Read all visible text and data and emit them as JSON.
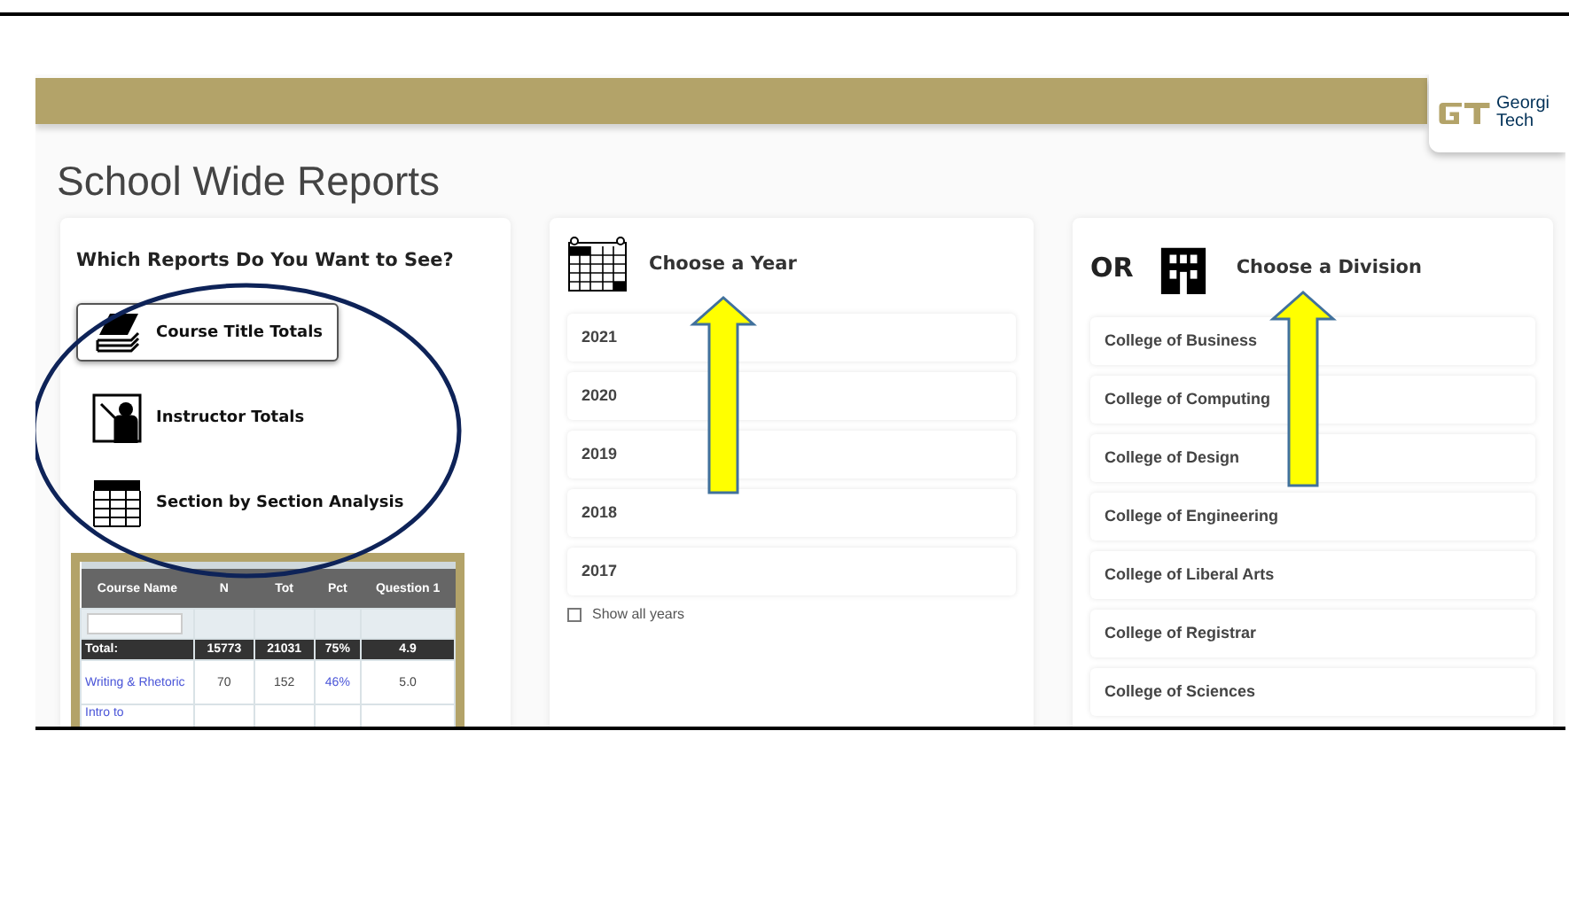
{
  "logo": {
    "line_1": "Georgi",
    "line_2": "Tech"
  },
  "page_title": "School Wide Reports",
  "reports": {
    "heading": "Which Reports Do You Want to See?",
    "options": [
      {
        "label": "Course Title Totals",
        "kind": "books",
        "selected": true
      },
      {
        "label": "Instructor Totals",
        "kind": "teacher",
        "selected": false
      },
      {
        "label": "Section by Section Analysis",
        "kind": "grid",
        "selected": false
      }
    ],
    "preview_table": {
      "columns": [
        "Course Name",
        "N",
        "Tot",
        "Pct",
        "Question 1"
      ],
      "total": [
        "Total:",
        "15773",
        "21031",
        "75%",
        "4.9"
      ],
      "rows": [
        [
          "Writing & Rhetoric",
          "70",
          "152",
          "46%",
          "5.0"
        ],
        [
          "Intro to",
          "",
          "",
          "",
          ""
        ]
      ]
    }
  },
  "years": {
    "heading": "Choose a Year",
    "items": [
      "2021",
      "2020",
      "2019",
      "2018",
      "2017"
    ],
    "show_all": {
      "label": "Show all years",
      "checked": false
    }
  },
  "divisions": {
    "prefix": "OR",
    "heading": "Choose a Division",
    "items": [
      "College of Business",
      "College of Computing",
      "College of Design",
      "College of Engineering",
      "College of Liberal Arts",
      "College of Registrar",
      "College of Sciences"
    ]
  }
}
